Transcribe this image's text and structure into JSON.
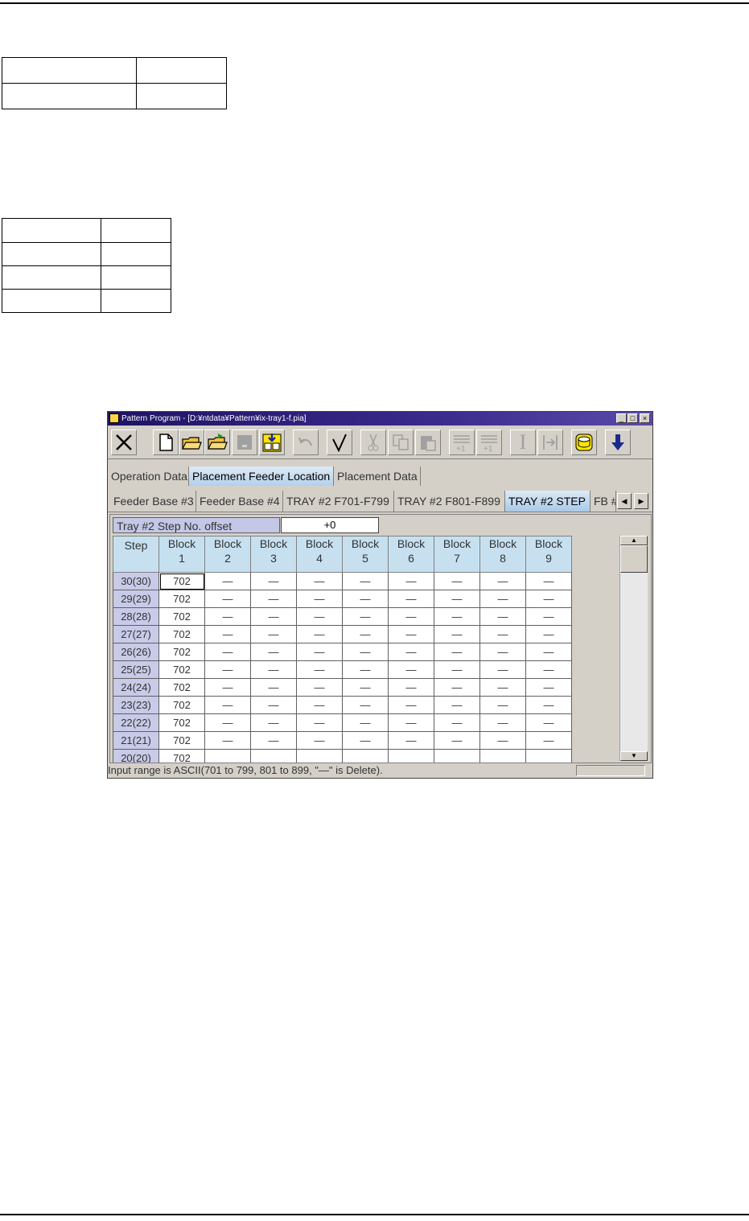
{
  "window": {
    "title": "Pattern Program - [D:¥ntdata¥Pattern¥ix-tray1-f.pia]",
    "controls": {
      "minimize": "_",
      "maximize": "□",
      "close": "×"
    }
  },
  "toolbar": {
    "buttons": [
      {
        "name": "exit",
        "icon": "close-x-icon"
      },
      {
        "name": "new",
        "icon": "new-file-icon"
      },
      {
        "name": "open",
        "icon": "open-folder-icon"
      },
      {
        "name": "open-other",
        "icon": "open-folder-green-icon"
      },
      {
        "name": "save",
        "icon": "save-disabled-icon"
      },
      {
        "name": "save-as",
        "icon": "save-as-icon"
      },
      {
        "name": "undo",
        "icon": "undo-icon"
      },
      {
        "name": "check",
        "icon": "checkmark-icon"
      },
      {
        "name": "cut",
        "icon": "scissors-icon"
      },
      {
        "name": "copy",
        "icon": "copy-icon"
      },
      {
        "name": "paste",
        "icon": "paste-icon"
      },
      {
        "name": "insert-step",
        "icon": "insert-plus-one-icon",
        "label": "+1"
      },
      {
        "name": "add-step",
        "icon": "append-plus-one-icon",
        "label": "+1"
      },
      {
        "name": "insert-cursor",
        "icon": "text-cursor-icon",
        "label": "I"
      },
      {
        "name": "jump",
        "icon": "jump-to-icon"
      },
      {
        "name": "database",
        "icon": "database-icon"
      },
      {
        "name": "download",
        "icon": "download-arrow-icon"
      }
    ]
  },
  "main_tabs": [
    {
      "label": "Operation Data",
      "active": false
    },
    {
      "label": "Placement Feeder Location",
      "active": true
    },
    {
      "label": "Placement Data",
      "active": false
    }
  ],
  "sub_tabs": [
    {
      "label": "Feeder Base #3",
      "active": false
    },
    {
      "label": "Feeder Base #4",
      "active": false
    },
    {
      "label": "TRAY #2 F701-F799",
      "active": false
    },
    {
      "label": "TRAY #2 F801-F899",
      "active": false
    },
    {
      "label": "TRAY #2 STEP",
      "active": true
    },
    {
      "label": "FB #",
      "active": false
    }
  ],
  "tab_scroll": {
    "left": "◀",
    "right": "▶"
  },
  "offset": {
    "label": "Tray #2 Step No. offset",
    "value": "+0"
  },
  "grid": {
    "step_header": "Step",
    "block_label": "Block",
    "block_numbers": [
      "1",
      "2",
      "3",
      "4",
      "5",
      "6",
      "7",
      "8",
      "9"
    ],
    "rows": [
      {
        "step": "30(30)",
        "cells": [
          "702",
          "—",
          "—",
          "—",
          "—",
          "—",
          "—",
          "—",
          "—"
        ]
      },
      {
        "step": "29(29)",
        "cells": [
          "702",
          "—",
          "—",
          "—",
          "—",
          "—",
          "—",
          "—",
          "—"
        ]
      },
      {
        "step": "28(28)",
        "cells": [
          "702",
          "—",
          "—",
          "—",
          "—",
          "—",
          "—",
          "—",
          "—"
        ]
      },
      {
        "step": "27(27)",
        "cells": [
          "702",
          "—",
          "—",
          "—",
          "—",
          "—",
          "—",
          "—",
          "—"
        ]
      },
      {
        "step": "26(26)",
        "cells": [
          "702",
          "—",
          "—",
          "—",
          "—",
          "—",
          "—",
          "—",
          "—"
        ]
      },
      {
        "step": "25(25)",
        "cells": [
          "702",
          "—",
          "—",
          "—",
          "—",
          "—",
          "—",
          "—",
          "—"
        ]
      },
      {
        "step": "24(24)",
        "cells": [
          "702",
          "—",
          "—",
          "—",
          "—",
          "—",
          "—",
          "—",
          "—"
        ]
      },
      {
        "step": "23(23)",
        "cells": [
          "702",
          "—",
          "—",
          "—",
          "—",
          "—",
          "—",
          "—",
          "—"
        ]
      },
      {
        "step": "22(22)",
        "cells": [
          "702",
          "—",
          "—",
          "—",
          "—",
          "—",
          "—",
          "—",
          "—"
        ]
      },
      {
        "step": "21(21)",
        "cells": [
          "702",
          "—",
          "—",
          "—",
          "—",
          "—",
          "—",
          "—",
          "—"
        ]
      },
      {
        "step": "20(20)",
        "cells": [
          "702",
          "",
          "",
          "",
          "",
          "",
          "",
          "",
          ""
        ]
      }
    ]
  },
  "scrollbar": {
    "up": "▲",
    "down": "▼"
  },
  "status": {
    "text": "Input range is ASCII(701 to 799, 801 to 899, \"—\" is Delete)."
  }
}
